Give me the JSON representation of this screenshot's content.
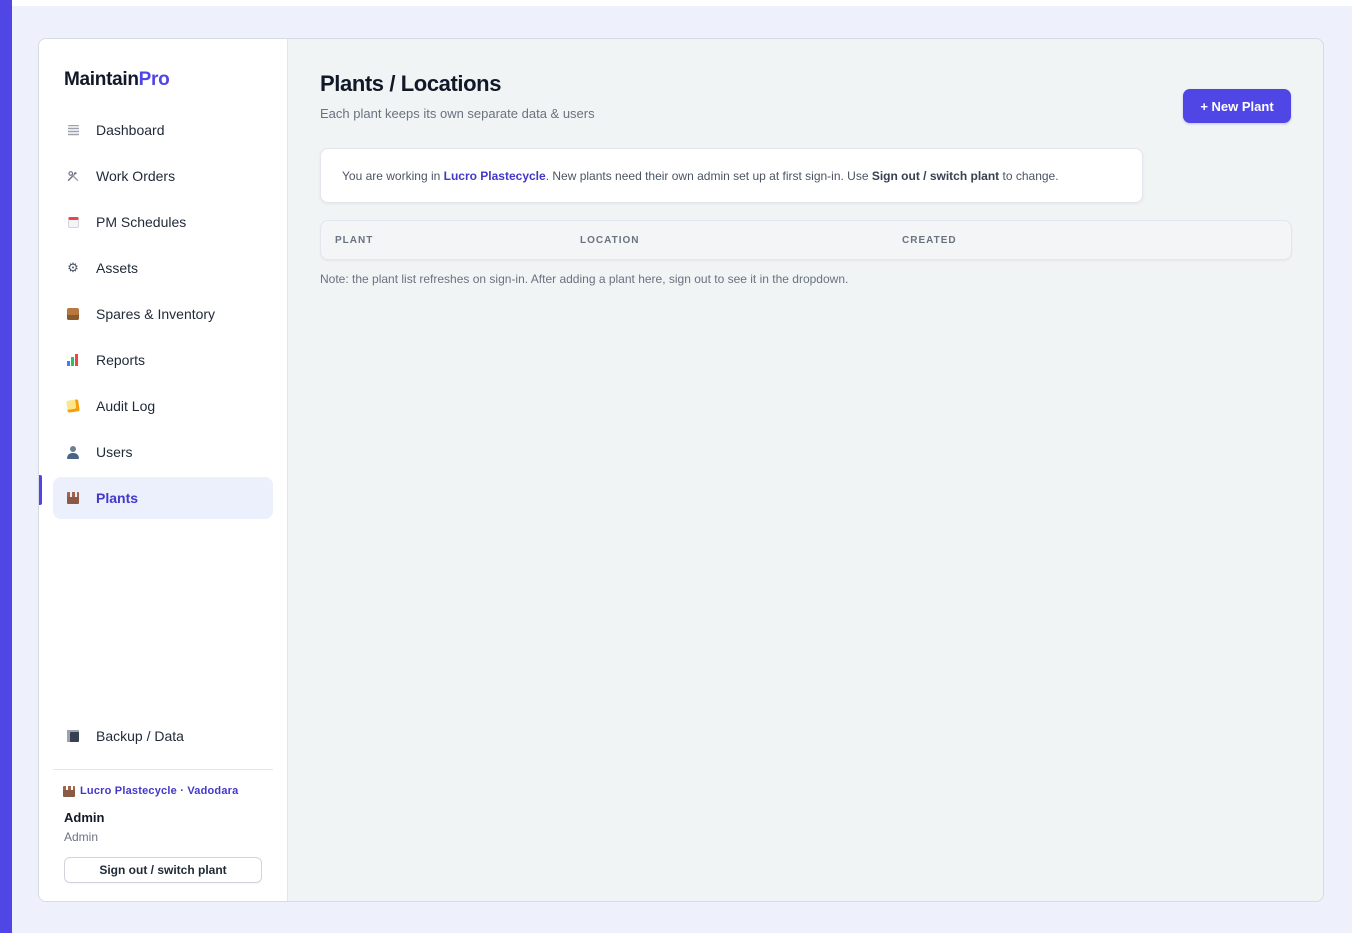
{
  "brand": {
    "name_main": "Maintain",
    "name_accent": "Pro"
  },
  "colors": {
    "accent": "#4f46e5",
    "active_bg": "#eceffc",
    "content_bg": "#f0f4f4"
  },
  "sidebar": {
    "items": [
      {
        "label": "Dashboard",
        "icon": "document-icon",
        "active": false
      },
      {
        "label": "Work Orders",
        "icon": "tools-icon",
        "active": false
      },
      {
        "label": "PM Schedules",
        "icon": "calendar-icon",
        "active": false
      },
      {
        "label": "Assets",
        "icon": "gear-icon",
        "active": false
      },
      {
        "label": "Spares & Inventory",
        "icon": "package-icon",
        "active": false
      },
      {
        "label": "Reports",
        "icon": "bar-chart-icon",
        "active": false
      },
      {
        "label": "Audit Log",
        "icon": "memo-icon",
        "active": false
      },
      {
        "label": "Users",
        "icon": "user-icon",
        "active": false
      },
      {
        "label": "Plants",
        "icon": "factory-icon",
        "active": true
      }
    ],
    "backup": {
      "label": "Backup / Data",
      "icon": "floppy-disk-icon"
    },
    "current_plant": "Lucro Plastecycle · Vadodara",
    "user_name": "Admin",
    "user_role": "Admin",
    "signout_label": "Sign out / switch plant"
  },
  "main": {
    "title": "Plants / Locations",
    "subtitle": "Each plant keeps its own separate data & users",
    "new_button": "+ New Plant",
    "info": {
      "prefix": "You are working in ",
      "plant": "Lucro Plastecycle",
      "middle": ". New plants need their own admin set up at first sign-in. Use ",
      "action": "Sign out / switch plant",
      "suffix": " to change."
    },
    "table": {
      "columns": [
        "PLANT",
        "LOCATION",
        "CREATED"
      ],
      "rows": []
    },
    "note": "Note: the plant list refreshes on sign-in. After adding a plant here, sign out to see it in the dropdown."
  }
}
